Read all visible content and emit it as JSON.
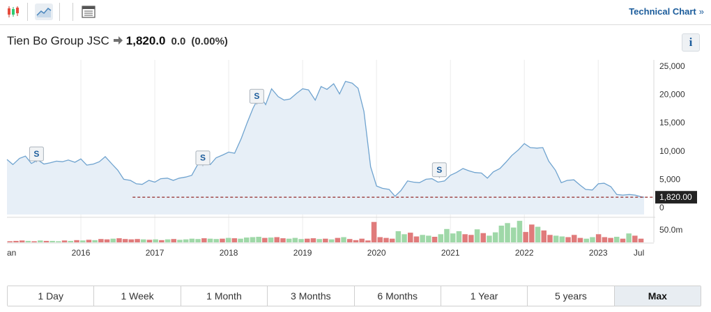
{
  "toolbar": {
    "icons": [
      "candlestick-icon",
      "line-chart-icon",
      "table-view-icon"
    ],
    "technical_chart_label": "Technical Chart",
    "technical_chart_chevron": "»"
  },
  "quote": {
    "name": "Tien Bo Group JSC",
    "price": "1,820.0",
    "change": "0.0",
    "change_percent": "(0.00%)",
    "direction_icon": "arrow-right-icon"
  },
  "info_label": "i",
  "colors": {
    "line": "#6fa3cf",
    "area": "#e7eff7",
    "reference_line": "#9b3b3b",
    "volume_up": "#9fd8a8",
    "volume_down": "#e07b7b",
    "price_tag_bg": "#222222",
    "accent": "#1b5c9b"
  },
  "chart_data": {
    "type": "area",
    "x_axis_labels": [
      "an",
      "2016",
      "2017",
      "2018",
      "2019",
      "2020",
      "2021",
      "2022",
      "2023",
      "Jul"
    ],
    "y_ticks": [
      "25,000",
      "20,000",
      "15,000",
      "10,000",
      "5,000",
      "0"
    ],
    "ylim": [
      0,
      25000
    ],
    "last_price_label": "1,820.00",
    "reference_value": 1820,
    "volume_axis_label": "50.0m",
    "volume_max": 60,
    "event_marker_label": "S",
    "event_markers": [
      {
        "x": 2015.4,
        "value": 8000
      },
      {
        "x": 2017.65,
        "value": 7300
      },
      {
        "x": 2018.38,
        "value": 18200
      },
      {
        "x": 2020.85,
        "value": 5200
      }
    ],
    "series": [
      {
        "x": [
          2015.0,
          2015.08,
          2015.17,
          2015.25,
          2015.33,
          2015.42,
          2015.5,
          2015.58,
          2015.67,
          2015.75,
          2015.83,
          2015.92,
          2016.0,
          2016.08,
          2016.17,
          2016.25,
          2016.33,
          2016.42,
          2016.5,
          2016.58,
          2016.67,
          2016.75,
          2016.83,
          2016.92,
          2017.0,
          2017.08,
          2017.17,
          2017.25,
          2017.33,
          2017.42,
          2017.5,
          2017.58,
          2017.67,
          2017.75,
          2017.83,
          2017.92,
          2018.0,
          2018.08,
          2018.17,
          2018.25,
          2018.33,
          2018.42,
          2018.5,
          2018.58,
          2018.67,
          2018.75,
          2018.83,
          2018.92,
          2019.0,
          2019.08,
          2019.17,
          2019.25,
          2019.33,
          2019.42,
          2019.5,
          2019.58,
          2019.67,
          2019.75,
          2019.83,
          2019.92,
          2020.0,
          2020.08,
          2020.17,
          2020.25,
          2020.33,
          2020.42,
          2020.5,
          2020.58,
          2020.67,
          2020.75,
          2020.83,
          2020.92,
          2021.0,
          2021.08,
          2021.17,
          2021.25,
          2021.33,
          2021.42,
          2021.5,
          2021.58,
          2021.67,
          2021.75,
          2021.83,
          2021.92,
          2022.0,
          2022.08,
          2022.17,
          2022.25,
          2022.33,
          2022.42,
          2022.5,
          2022.58,
          2022.67,
          2022.75,
          2022.83,
          2022.92,
          2023.0,
          2023.08,
          2023.17,
          2023.25,
          2023.33,
          2023.42,
          2023.5,
          2023.58,
          2023.62
        ],
        "values": [
          8500,
          7600,
          8700,
          9100,
          7800,
          8400,
          7700,
          7900,
          8200,
          8100,
          8400,
          8000,
          8600,
          7500,
          7700,
          8100,
          9000,
          7700,
          6600,
          5000,
          4800,
          4200,
          4100,
          4800,
          4500,
          5100,
          5200,
          4800,
          5200,
          5400,
          5700,
          7600,
          8000,
          7600,
          8800,
          9300,
          9800,
          9600,
          12200,
          15000,
          17600,
          19800,
          18200,
          21000,
          19600,
          19000,
          19200,
          20200,
          21000,
          20800,
          19000,
          21400,
          20900,
          21900,
          20100,
          22300,
          22000,
          21100,
          17000,
          7200,
          3800,
          3400,
          3200,
          2000,
          3000,
          4700,
          4500,
          4400,
          5000,
          5100,
          4500,
          4700,
          5700,
          6200,
          6900,
          6500,
          6200,
          6100,
          5200,
          6300,
          6900,
          8000,
          9200,
          10200,
          11300,
          10600,
          10500,
          10600,
          8200,
          6600,
          4400,
          4800,
          4900,
          4000,
          3200,
          3100,
          4200,
          4300,
          3700,
          2300,
          2200,
          2300,
          2200,
          1900,
          1820
        ]
      }
    ],
    "volume": {
      "up": [
        0,
        0,
        0,
        1,
        0,
        1,
        0,
        1,
        1,
        0,
        1,
        0,
        1,
        0,
        1,
        0,
        0,
        1,
        0,
        0,
        0,
        0,
        1,
        0,
        1,
        0,
        1,
        0,
        1,
        1,
        1,
        1,
        0,
        1,
        1,
        0,
        1,
        0,
        1,
        1,
        1,
        1,
        0,
        1,
        0,
        0,
        1,
        1,
        1,
        0,
        0,
        1,
        0,
        1,
        0,
        1,
        0,
        0,
        0,
        0,
        0,
        0,
        0,
        0,
        1,
        1,
        0,
        0,
        1,
        1,
        0,
        1,
        1,
        1,
        1,
        0,
        0,
        1,
        0,
        1,
        1,
        1,
        1,
        1,
        1,
        0,
        0,
        1,
        0,
        0,
        1,
        1,
        0,
        0,
        0,
        1,
        1,
        0,
        0,
        0,
        1,
        0,
        1,
        0,
        0
      ],
      "values": [
        3,
        4,
        5,
        4,
        3,
        5,
        4,
        4,
        3,
        5,
        4,
        6,
        5,
        7,
        6,
        9,
        8,
        10,
        11,
        9,
        8,
        9,
        8,
        7,
        8,
        6,
        8,
        9,
        7,
        8,
        10,
        9,
        11,
        10,
        9,
        10,
        12,
        11,
        10,
        13,
        14,
        15,
        12,
        13,
        14,
        11,
        10,
        12,
        9,
        10,
        11,
        9,
        10,
        8,
        12,
        14,
        9,
        6,
        10,
        5,
        55,
        14,
        12,
        10,
        30,
        22,
        26,
        16,
        20,
        18,
        15,
        22,
        36,
        24,
        30,
        22,
        20,
        35,
        25,
        18,
        27,
        45,
        52,
        40,
        58,
        28,
        48,
        42,
        32,
        20,
        18,
        16,
        14,
        20,
        12,
        10,
        14,
        22,
        14,
        12,
        15,
        10,
        24,
        18,
        10
      ]
    }
  }
}
